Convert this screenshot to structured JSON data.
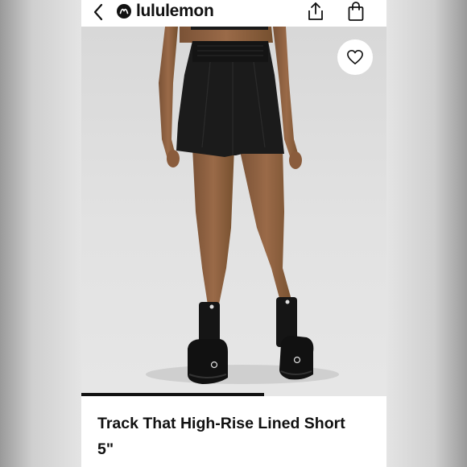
{
  "header": {
    "brand": "lululemon",
    "icons": [
      "back-arrow-icon",
      "lululemon-logo-icon",
      "share-icon",
      "shopping-bag-icon"
    ]
  },
  "product": {
    "title": "Track That High-Rise Lined Short 5\"",
    "image": "Back view of model wearing black high-rise shorts with black socks and black sneakers"
  },
  "gallery": {
    "progress": 0.6
  },
  "colors": {
    "background": "#ffffff",
    "text": "#111111",
    "product_black": "#1a1a1a"
  }
}
